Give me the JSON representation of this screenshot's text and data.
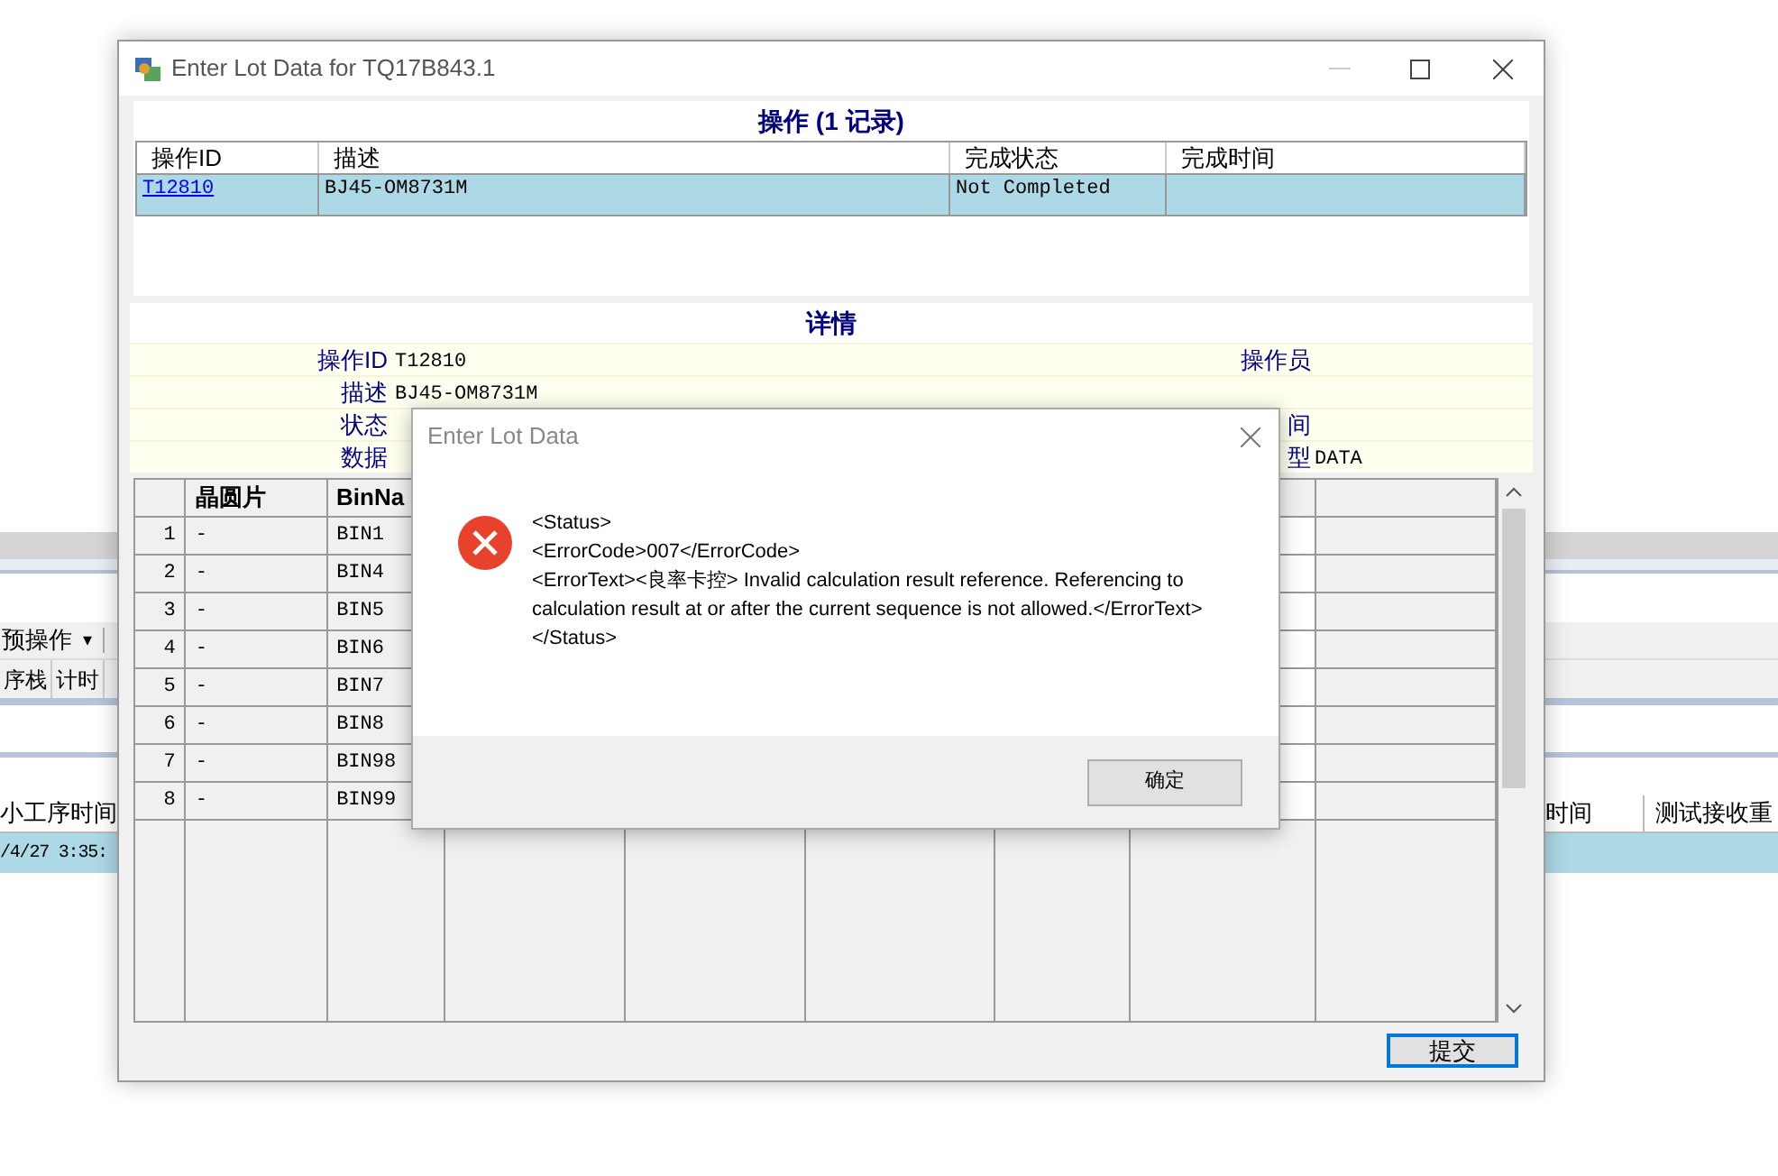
{
  "background_app": {
    "toolbar_item": "预操作",
    "toolbar_caret": "▾",
    "tabs": [
      "序栈",
      "计时"
    ],
    "table": {
      "columns": [
        "小工序时间",
        "时间",
        "测试接收重"
      ],
      "rows": [
        {
          "cells": [
            "/4/27 3:35:"
          ],
          "selected": true
        }
      ]
    }
  },
  "window": {
    "title": "Enter Lot Data for TQ17B843.1",
    "operations": {
      "title": "操作 (1 记录)",
      "columns": [
        "操作ID",
        "描述",
        "完成状态",
        "完成时间"
      ],
      "rows": [
        {
          "cells": [
            "T12810",
            "BJ45-OM8731M",
            "Not Completed",
            ""
          ],
          "selected": true
        }
      ]
    },
    "details": {
      "title": "详情",
      "rows": [
        {
          "label": "操作ID",
          "value": "T12810",
          "right_label": "操作员"
        },
        {
          "label": "描述",
          "value": "BJ45-OM8731M"
        },
        {
          "label": "状态",
          "right_label": "间"
        },
        {
          "label": "数据",
          "right_label": "型",
          "right_value": "DATA"
        }
      ]
    },
    "bins": {
      "columns": [
        "晶圆片",
        "BinNa"
      ],
      "rows": [
        {
          "index": "1",
          "wafer": "-",
          "bin": "BIN1"
        },
        {
          "index": "2",
          "wafer": "-",
          "bin": "BIN4"
        },
        {
          "index": "3",
          "wafer": "-",
          "bin": "BIN5"
        },
        {
          "index": "4",
          "wafer": "-",
          "bin": "BIN6"
        },
        {
          "index": "5",
          "wafer": "-",
          "bin": "BIN7"
        },
        {
          "index": "6",
          "wafer": "-",
          "bin": "BIN8"
        },
        {
          "index": "7",
          "wafer": "-",
          "bin": "BIN98"
        },
        {
          "index": "8",
          "wafer": "-",
          "bin": "BIN99"
        }
      ]
    },
    "submit": "提交"
  },
  "dialog": {
    "title": "Enter Lot Data",
    "lines": [
      "<Status>",
      "<ErrorCode>007</ErrorCode>",
      "<ErrorText><良率卡控> Invalid calculation result reference. Referencing to calculation result at or after the current sequence is not allowed.</ErrorText>",
      "</Status>"
    ],
    "button": "确定"
  }
}
